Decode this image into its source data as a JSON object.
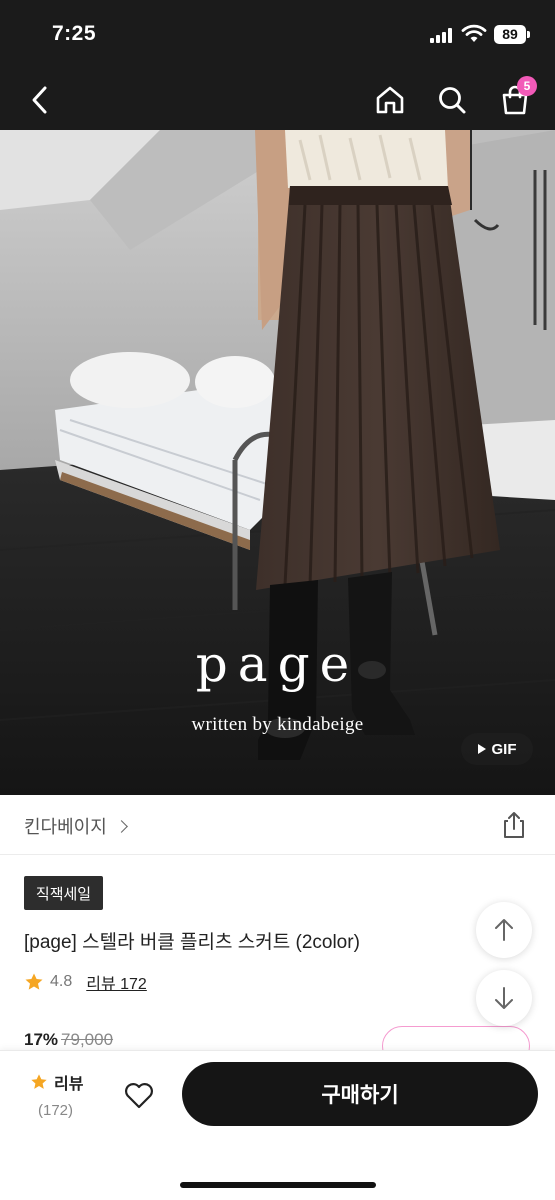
{
  "status_bar": {
    "time": "7:25",
    "battery": "89"
  },
  "nav": {
    "back_icon": "chevron-left-icon",
    "home_icon": "home-icon",
    "search_icon": "search-icon",
    "cart_icon": "shopping-bag-icon",
    "cart_count": "5"
  },
  "hero": {
    "brand_logo": "page",
    "brand_subtitle": "written by kindabeige",
    "gif_label": "GIF"
  },
  "brand": {
    "name": "킨다베이지",
    "share_icon": "share-icon"
  },
  "product": {
    "sale_tag": "직잭세일",
    "title": "[page] 스텔라 버클 플리츠 스커트 (2color)",
    "rating": "4.8",
    "review_link": "리뷰 172",
    "discount": "17%",
    "original_price": "79,000"
  },
  "bottom_bar": {
    "review_label": "리뷰",
    "review_count": "(172)",
    "buy_label": "구매하기"
  },
  "colors": {
    "dark_bar": "#1b1b1b",
    "badge_pink": "#f25ab8",
    "star": "#f5a623",
    "coupon_border": "#f59bd0"
  }
}
